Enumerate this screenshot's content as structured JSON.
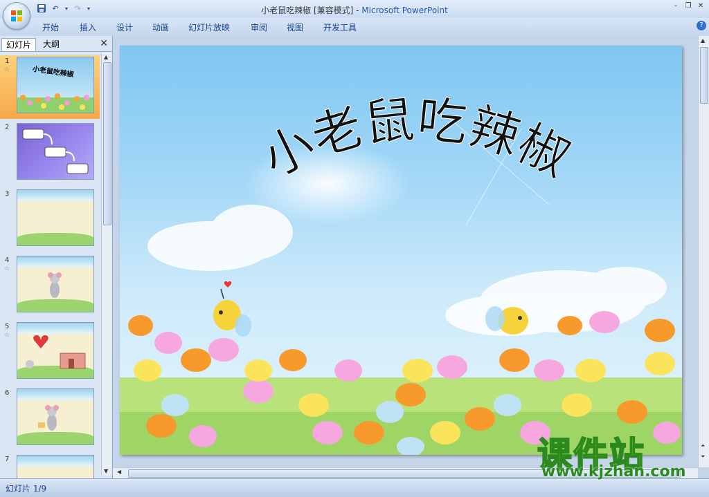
{
  "window": {
    "title": "小老鼠吃辣椒 [兼容模式]",
    "separator": " - ",
    "app_name": "Microsoft PowerPoint"
  },
  "ribbon_tabs": [
    "开始",
    "插入",
    "设计",
    "动画",
    "幻灯片放映",
    "审阅",
    "视图",
    "开发工具"
  ],
  "left_panel": {
    "tabs": [
      "幻灯片",
      "大纲"
    ],
    "slides": [
      {
        "num": "1",
        "has_animation": true,
        "mini_title": "小老鼠吃辣椒",
        "selected": true
      },
      {
        "num": "2",
        "has_animation": false
      },
      {
        "num": "3",
        "has_animation": false
      },
      {
        "num": "4",
        "has_animation": true
      },
      {
        "num": "5",
        "has_animation": true
      },
      {
        "num": "6",
        "has_animation": false
      },
      {
        "num": "7",
        "has_animation": false
      }
    ]
  },
  "slide": {
    "title": "小老鼠吃辣椒"
  },
  "status_bar": {
    "slide_indicator": "幻灯片 1/9"
  },
  "watermark": {
    "logo_text": "课件站",
    "url": "www.kjzhan.com"
  },
  "colors": {
    "ribbon_text": "#15428b",
    "selected_thumb": "#f8a84a",
    "watermark_yellow": "#ffe600",
    "watermark_green": "#2a8a1e"
  }
}
